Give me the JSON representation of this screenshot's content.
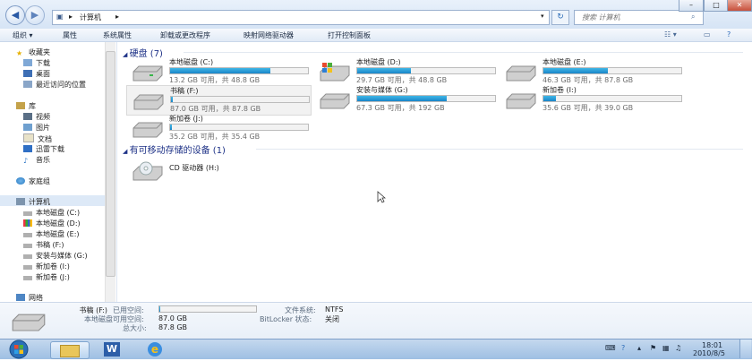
{
  "window": {
    "address": [
      "计算机"
    ],
    "search_placeholder": "搜索 计算机",
    "buttons": {
      "minimize": "–",
      "maximize": "□",
      "close": "✕"
    }
  },
  "toolbar": {
    "organize": "组织",
    "items": [
      "属性",
      "系统属性",
      "卸载或更改程序",
      "映射网络驱动器",
      "打开控制面板"
    ]
  },
  "nav": {
    "favorites": "收藏夹",
    "favorites_items": [
      "下载",
      "桌面",
      "最近访问的位置"
    ],
    "libraries": "库",
    "library_items": [
      "视频",
      "图片",
      "文档",
      "迅雷下载",
      "音乐"
    ],
    "homegroup": "家庭组",
    "computer": "计算机",
    "computer_items": [
      "本地磁盘 (C:)",
      "本地磁盘 (D:)",
      "本地磁盘 (E:)",
      "书稿 (F:)",
      "安装与媒体 (G:)",
      "新加卷 (I:)",
      "新加卷 (J:)"
    ],
    "network": "网络"
  },
  "groups": {
    "hard_disks": "硬盘 (7)",
    "removable": "有可移动存储的设备 (1)"
  },
  "drives": [
    {
      "name": "本地磁盘 (C:)",
      "info": "13.2 GB 可用，共 48.8 GB",
      "used_fraction": 0.73
    },
    {
      "name": "本地磁盘 (D:)",
      "info": "29.7 GB 可用，共 48.8 GB",
      "used_fraction": 0.39
    },
    {
      "name": "本地磁盘 (E:)",
      "info": "46.3 GB 可用，共 87.8 GB",
      "used_fraction": 0.47
    },
    {
      "name": "书稿 (F:)",
      "info": "87.0 GB 可用，共 87.8 GB",
      "used_fraction": 0.01
    },
    {
      "name": "安装与媒体 (G:)",
      "info": "67.3 GB 可用，共 192 GB",
      "used_fraction": 0.65
    },
    {
      "name": "新加卷 (I:)",
      "info": "35.6 GB 可用，共 39.0 GB",
      "used_fraction": 0.09
    },
    {
      "name": "新加卷 (J:)",
      "info": "35.2 GB 可用，共 35.4 GB",
      "used_fraction": 0.01
    }
  ],
  "cd_drive": "CD 驱动器 (H:)",
  "details": {
    "title": "书稿 (F:)",
    "subtitle": "本地磁盘",
    "used_label": "已用空间:",
    "free_label": "可用空间:",
    "free_value": "87.0 GB",
    "total_label": "总大小:",
    "total_value": "87.8 GB",
    "fs_label": "文件系统:",
    "fs_value": "NTFS",
    "bitlocker_label": "BitLocker 状态:",
    "bitlocker_value": "关闭",
    "used_fraction": 0.01
  },
  "taskbar": {
    "clock_time": "18:01",
    "clock_date": "2010/8/5"
  }
}
